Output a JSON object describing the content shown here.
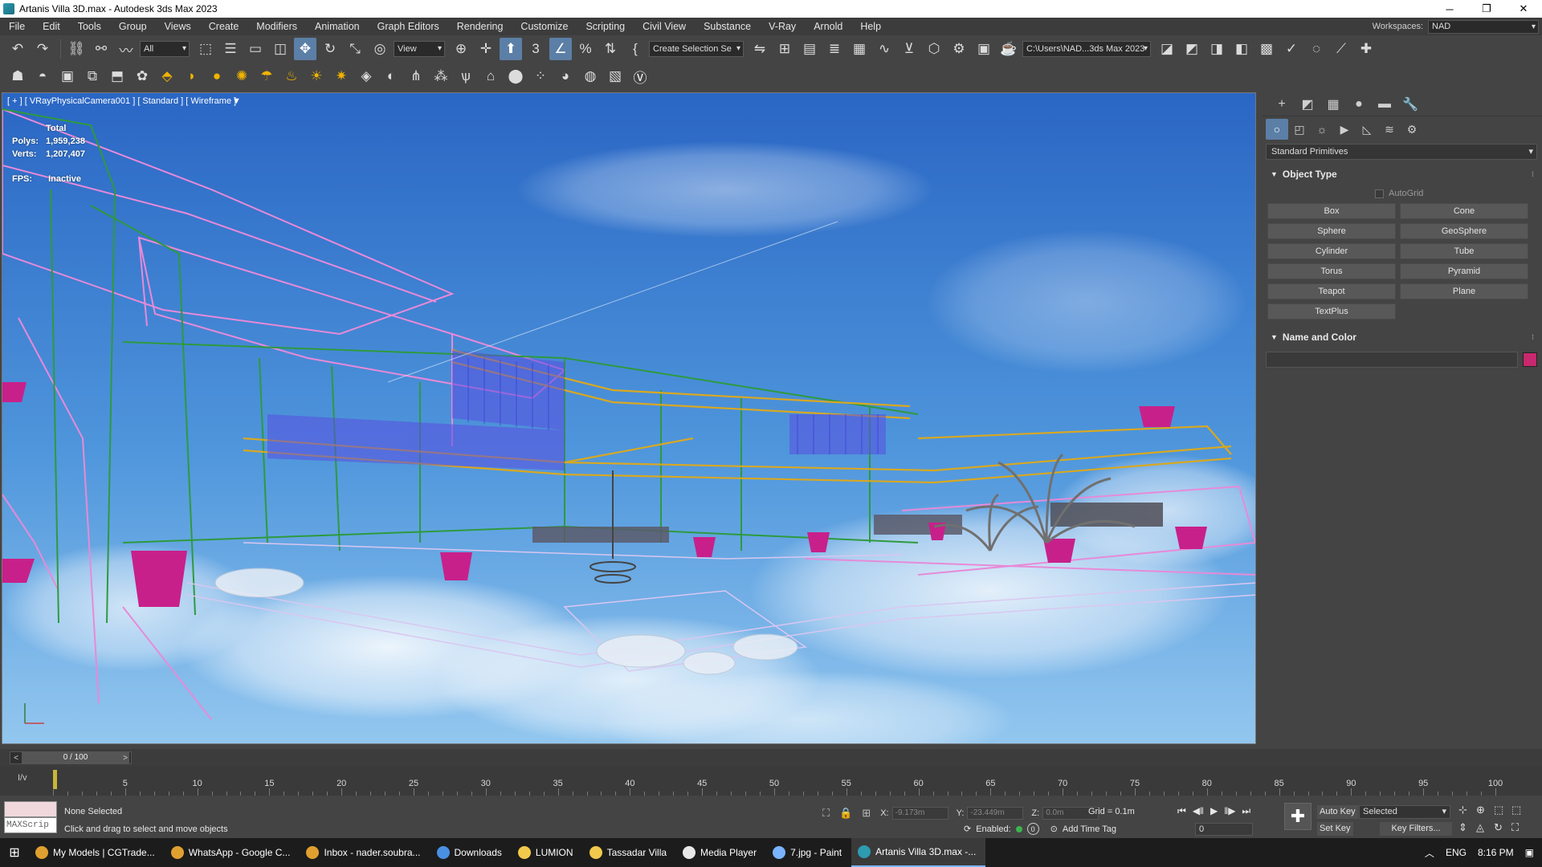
{
  "window": {
    "title": "Artanis Villa 3D.max - Autodesk 3ds Max 2023",
    "controls": [
      "─",
      "❐",
      "✕"
    ]
  },
  "menu": [
    "File",
    "Edit",
    "Tools",
    "Group",
    "Views",
    "Create",
    "Modifiers",
    "Animation",
    "Graph Editors",
    "Rendering",
    "Customize",
    "Scripting",
    "Civil View",
    "Substance",
    "V-Ray",
    "Arnold",
    "Help"
  ],
  "workspaces": {
    "label": "Workspaces:",
    "value": "NAD"
  },
  "toolbar": {
    "filter_select": "All",
    "ref_coord": "View",
    "selection_set": "Create Selection Se",
    "project_path": "C:\\Users\\NAD...3ds Max 2023"
  },
  "viewport": {
    "label": "[ + ] [ VRayPhysicalCamera001 ] [ Standard ] [ Wireframe ]",
    "stats": {
      "header": "Total",
      "polys_label": "Polys:",
      "polys": "1,959,238",
      "verts_label": "Verts:",
      "verts": "1,207,407"
    },
    "fps_label": "FPS:",
    "fps_value": "Inactive"
  },
  "command_panel": {
    "category": "Standard Primitives",
    "object_type_title": "Object Type",
    "autogrid": "AutoGrid",
    "buttons": [
      "Box",
      "Cone",
      "Sphere",
      "GeoSphere",
      "Cylinder",
      "Tube",
      "Torus",
      "Pyramid",
      "Teapot",
      "Plane",
      "TextPlus"
    ],
    "name_color_title": "Name and Color",
    "name_value": "",
    "color": "#c8286e"
  },
  "time_slider": {
    "value": "0 / 100"
  },
  "track_bar": {
    "ticks": [
      5,
      10,
      15,
      20,
      25,
      30,
      35,
      40,
      45,
      50,
      55,
      60,
      65,
      70,
      75,
      80,
      85,
      90,
      95,
      100
    ]
  },
  "status": {
    "maxscript": "MAXScrip",
    "selection": "None Selected",
    "prompt": "Click and drag to select and move objects",
    "x_label": "X:",
    "x_value": "-9.173m",
    "y_label": "Y:",
    "y_value": "-23.449m",
    "z_label": "Z:",
    "z_value": "0.0m",
    "grid": "Grid = 0.1m",
    "enabled": "Enabled:",
    "enabled_count": "0",
    "add_time_tag": "Add Time Tag",
    "frame": "0",
    "auto_key": "Auto Key",
    "set_key": "Set Key",
    "key_mode": "Selected",
    "key_filters": "Key Filters..."
  },
  "taskbar": {
    "items": [
      {
        "label": "My Models | CGTrade...",
        "color": "#e0a030"
      },
      {
        "label": "WhatsApp - Google C...",
        "color": "#e0a030"
      },
      {
        "label": "Inbox - nader.soubra...",
        "color": "#e0a030"
      },
      {
        "label": "Downloads",
        "color": "#4a90e2"
      },
      {
        "label": "LUMION",
        "color": "#f2c94c"
      },
      {
        "label": "Tassadar Villa",
        "color": "#f2c94c"
      },
      {
        "label": "Media Player",
        "color": "#e8e8e8"
      },
      {
        "label": "7.jpg - Paint",
        "color": "#7ab4ff"
      },
      {
        "label": "Artanis Villa 3D.max -...",
        "color": "#2d9bb0"
      }
    ],
    "lang": "ENG",
    "time": "8:16 PM"
  },
  "colors": {
    "accent": "#5b7fa6",
    "sky_top": "#2e6fc9",
    "sky_bottom": "#8ec3ee",
    "wire_green": "#2e9a3e",
    "wire_pink": "#e78ad8",
    "wire_gold": "#d9a820",
    "magenta": "#c8208a"
  }
}
